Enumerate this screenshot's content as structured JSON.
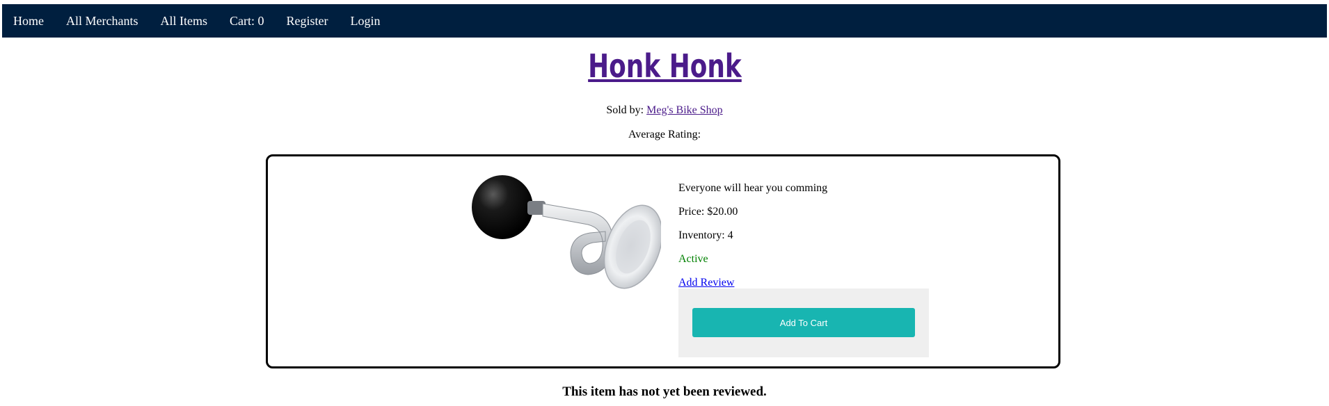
{
  "nav": {
    "items": [
      {
        "label": "Home"
      },
      {
        "label": "All Merchants"
      },
      {
        "label": "All Items"
      },
      {
        "label": "Cart: 0"
      },
      {
        "label": "Register"
      },
      {
        "label": "Login"
      }
    ]
  },
  "item": {
    "name": "Honk Honk",
    "sold_by_prefix": "Sold by: ",
    "merchant": "Meg's Bike Shop",
    "average_rating_label": "Average Rating:",
    "description": "Everyone will hear you comming",
    "price": "Price: $20.00",
    "inventory": "Inventory: 4",
    "status": "Active",
    "add_review": "Add Review",
    "add_to_cart": "Add To Cart",
    "image_icon": "bike-horn-image"
  },
  "reviews": {
    "empty_message": "This item has not yet been reviewed."
  },
  "colors": {
    "navbar": "#001f3f",
    "title": "#4b1b8a",
    "active": "#008000",
    "cart_button": "#18b5b1"
  }
}
